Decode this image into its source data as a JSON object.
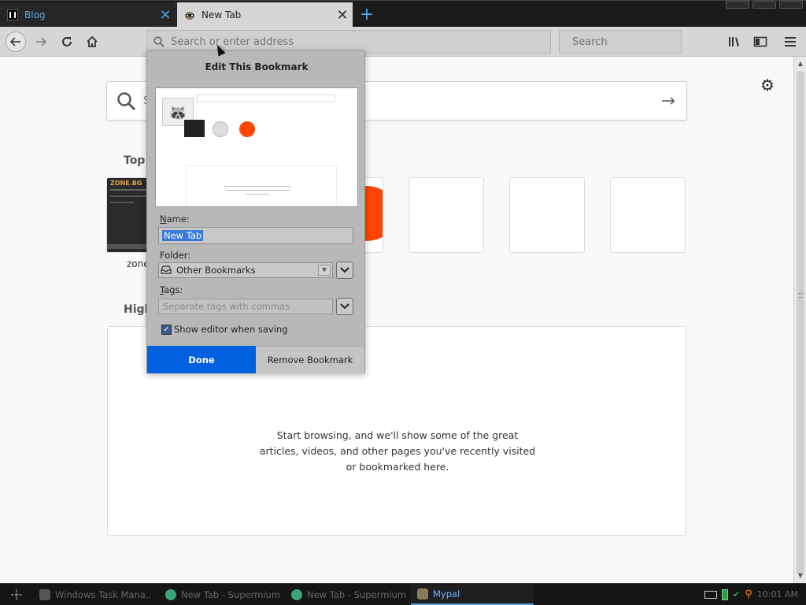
{
  "tabs": [
    {
      "title": "Blog",
      "favicon": "blog-favicon-icon",
      "active": false
    },
    {
      "title": "New Tab",
      "favicon": "raccoon-icon",
      "active": true
    }
  ],
  "nav": {
    "url_placeholder": "Search or enter address",
    "search_placeholder": "Search"
  },
  "page": {
    "search_hint": "S",
    "top_sites_title": "Top",
    "top_site_label": "zone",
    "zone_tile_text": "ZONE.BG",
    "highlights_title": "High",
    "empty_message": "Start browsing, and we'll show some of the great articles, videos, and other pages you've recently visited or bookmarked here."
  },
  "bookmark_panel": {
    "title": "Edit This Bookmark",
    "name_label": "Name:",
    "name_value": "New Tab",
    "folder_label": "Folder:",
    "folder_value": "Other Bookmarks",
    "tags_label": "Tags:",
    "tags_placeholder": "Separate tags with commas",
    "show_editor_label": "Show editor when saving",
    "show_editor_checked": true,
    "done_label": "Done",
    "remove_label": "Remove Bookmark"
  },
  "taskbar": {
    "items": [
      {
        "label": "Windows Task Mana..",
        "active": false
      },
      {
        "label": "New Tab - Supermium",
        "active": false
      },
      {
        "label": "New Tab - Supermium",
        "active": false
      },
      {
        "label": "Mypal",
        "active": true
      }
    ],
    "clock": "10:01 AM"
  },
  "colors": {
    "done_button": "#0060df",
    "tab_blog_text": "#5aa9e6",
    "reddit": "#ff4500"
  }
}
